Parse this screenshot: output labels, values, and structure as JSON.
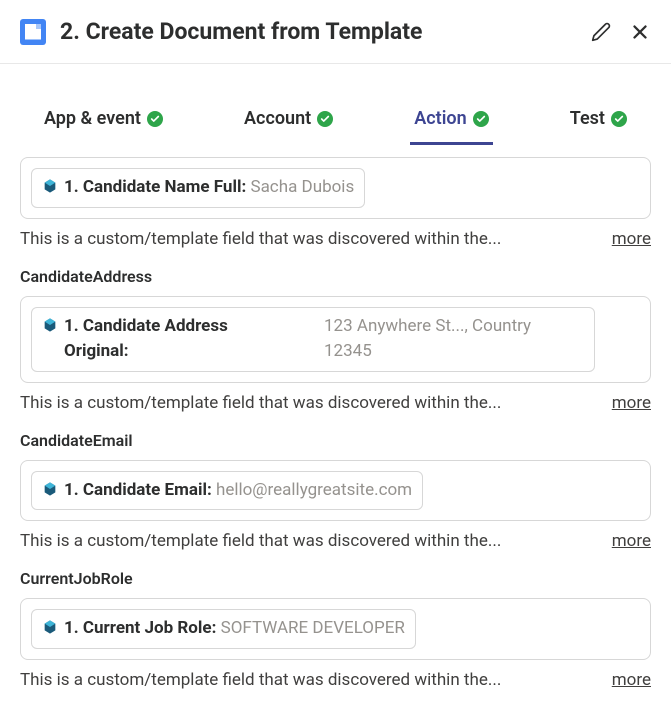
{
  "header": {
    "title": "2. Create Document from Template"
  },
  "tabs": {
    "appEvent": "App & event",
    "account": "Account",
    "action": "Action",
    "test": "Test"
  },
  "fields": {
    "candidateName": {
      "pillLabel": "1. Candidate Name Full:",
      "pillValue": "Sacha Dubois",
      "help": "This is a custom/template field that was discovered within the...",
      "more": "more"
    },
    "candidateAddress": {
      "label": "CandidateAddress",
      "pillLabel1": "1. Candidate Address",
      "pillLabel2": "Original:",
      "pillValue1": "123 Anywhere St..., Country",
      "pillValue2": "12345",
      "help": "This is a custom/template field that was discovered within the...",
      "more": "more"
    },
    "candidateEmail": {
      "label": "CandidateEmail",
      "pillLabel": "1. Candidate Email:",
      "pillValue": "hello@reallygreatsite.com",
      "help": "This is a custom/template field that was discovered within the...",
      "more": "more"
    },
    "currentJobRole": {
      "label": "CurrentJobRole",
      "pillLabel": "1. Current Job Role:",
      "pillValue": "SOFTWARE DEVELOPER",
      "help": "This is a custom/template field that was discovered within the...",
      "more": "more"
    }
  }
}
